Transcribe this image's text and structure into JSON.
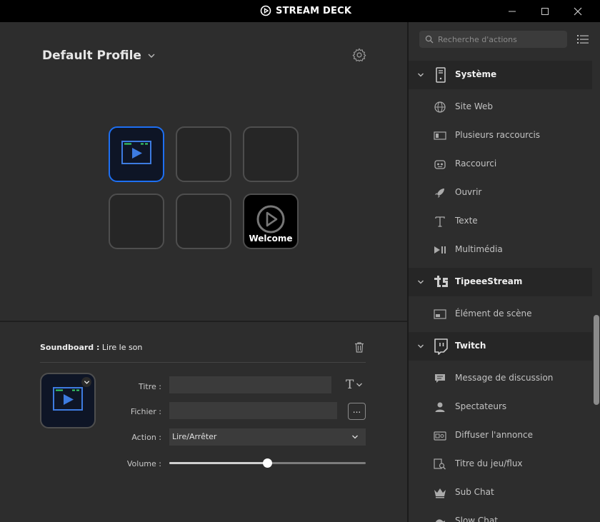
{
  "app": {
    "title": "STREAM DECK"
  },
  "profile": {
    "name": "Default Profile"
  },
  "keys": {
    "welcome_label": "Welcome"
  },
  "inspector": {
    "plugin": "Soundboard :",
    "action_name": "Lire le son",
    "labels": {
      "title": "Titre :",
      "file": "Fichier :",
      "action": "Action :",
      "volume": "Volume :"
    },
    "title_value": "",
    "file_value": "",
    "action_value": "Lire/Arrêter",
    "browse_label": "...",
    "volume_level": 0.5
  },
  "sidebar": {
    "search_placeholder": "Recherche d'actions",
    "categories": [
      {
        "label": "Système",
        "items": [
          "Site Web",
          "Plusieurs raccourcis",
          "Raccourci",
          "Ouvrir",
          "Texte",
          "Multimédia"
        ]
      },
      {
        "label": "TipeeeStream",
        "items": [
          "Élément de scène"
        ]
      },
      {
        "label": "Twitch",
        "items": [
          "Message de discussion",
          "Spectateurs",
          "Diffuser l'annonce",
          "Titre du jeu/flux",
          "Sub Chat",
          "Slow Chat"
        ]
      }
    ]
  },
  "colors": {
    "accent": "#1d6ff2",
    "background": "#2d2d2d",
    "titlebar": "#000000",
    "twitch": "#9146ff"
  }
}
